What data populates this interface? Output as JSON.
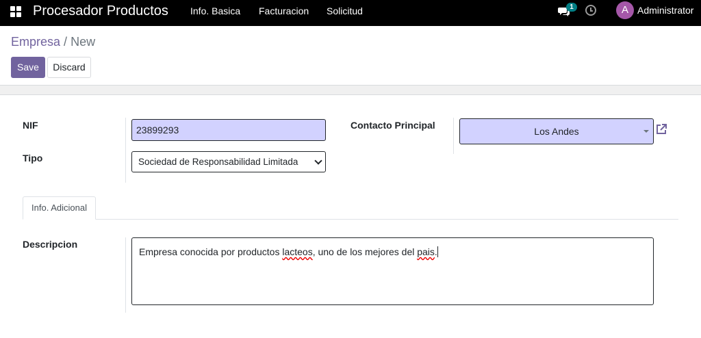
{
  "navbar": {
    "brand": "Procesador Productos",
    "menu": [
      "Info. Basica",
      "Facturacion",
      "Solicitud"
    ],
    "chat_count": "1",
    "user_initial": "A",
    "user_name": "Administrator",
    "colors": {
      "background": "#000000",
      "badge": "#017e84",
      "avatar": "#a557a8"
    }
  },
  "breadcrumb": {
    "parent": "Empresa",
    "separator": "/",
    "current": "New"
  },
  "buttons": {
    "save": "Save",
    "discard": "Discard"
  },
  "form": {
    "nif": {
      "label": "NIF",
      "value": "23899293"
    },
    "tipo": {
      "label": "Tipo",
      "value": "Sociedad de Responsabilidad Limitada"
    },
    "contacto": {
      "label": "Contacto Principal",
      "value": "Los Andes"
    },
    "tab": "Info. Adicional",
    "descripcion": {
      "label": "Descripcion",
      "value_part1": "Empresa conocida por productos ",
      "value_word1": "lacteos",
      "value_part2": ", uno de los mejores del ",
      "value_word2": "pais",
      "value_part3": "."
    }
  },
  "theme": {
    "primary": "#71639e",
    "required_field_bg": "#d2d2ff"
  }
}
